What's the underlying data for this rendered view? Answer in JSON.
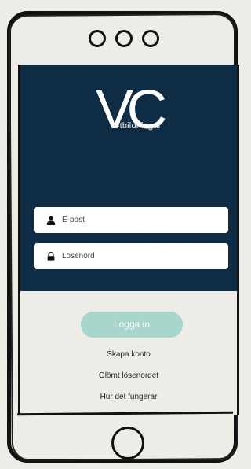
{
  "logo": {
    "mark": "VC",
    "subtitle": "Utbildningar"
  },
  "form": {
    "email_placeholder": "E-post",
    "password_placeholder": "Lösenord",
    "login_label": "Logga in"
  },
  "links": {
    "create_account": "Skapa konto",
    "forgot_password": "Glömt lösenordet",
    "how_it_works": "Hur det fungerar"
  },
  "colors": {
    "hero_background": "#0e2d45",
    "login_button": "#a6d6cc",
    "page_background": "#edece6"
  },
  "icons": {
    "email_field": "user-icon",
    "password_field": "lock-icon"
  }
}
